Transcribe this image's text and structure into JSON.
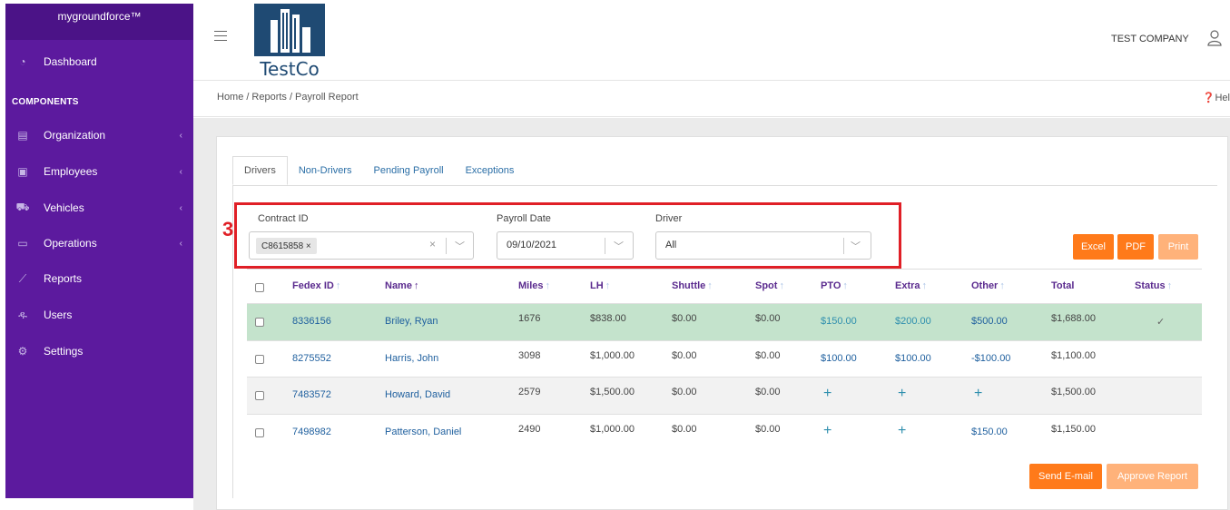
{
  "app": {
    "brand": "mygroundforce™",
    "logo_text": "TestCo",
    "company": "TEST COMPANY"
  },
  "sidebar": {
    "dashboard": "Dashboard",
    "section_title": "COMPONENTS",
    "items": [
      {
        "label": "Organization",
        "icon": "building-icon",
        "has_chevron": true
      },
      {
        "label": "Employees",
        "icon": "id-card-icon",
        "has_chevron": true
      },
      {
        "label": "Vehicles",
        "icon": "truck-icon",
        "has_chevron": true
      },
      {
        "label": "Operations",
        "icon": "calendar-icon",
        "has_chevron": true
      },
      {
        "label": "Reports",
        "icon": "chart-icon",
        "has_chevron": false
      },
      {
        "label": "Users",
        "icon": "users-icon",
        "has_chevron": false
      },
      {
        "label": "Settings",
        "icon": "gear-icon",
        "has_chevron": false
      }
    ]
  },
  "breadcrumb": {
    "home": "Home",
    "sep": "/",
    "reports": "Reports",
    "current": "Payroll Report",
    "help": "Hel"
  },
  "tabs": [
    "Drivers",
    "Non-Drivers",
    "Pending Payroll",
    "Exceptions"
  ],
  "filters": {
    "step_number": "3",
    "contract_label": "Contract ID",
    "contract_chip": "C8615858 ×",
    "date_label": "Payroll Date",
    "date_value": "09/10/2021",
    "driver_label": "Driver",
    "driver_value": "All"
  },
  "buttons": {
    "excel": "Excel",
    "pdf": "PDF",
    "print": "Print",
    "send_email": "Send E-mail",
    "approve": "Approve Report"
  },
  "table": {
    "headers": [
      "Fedex ID",
      "Name",
      "Miles",
      "LH",
      "Shuttle",
      "Spot",
      "PTO",
      "Extra",
      "Other",
      "Total",
      "Status"
    ],
    "rows": [
      {
        "id": "8336156",
        "name": "Briley, Ryan",
        "miles": "1676",
        "lh": "$838.00",
        "shuttle": "$0.00",
        "spot": "$0.00",
        "pto": "$150.00",
        "extra": "$200.00",
        "other": "$500.00",
        "total": "$1,688.00",
        "status": "✓"
      },
      {
        "id": "8275552",
        "name": "Harris, John",
        "miles": "3098",
        "lh": "$1,000.00",
        "shuttle": "$0.00",
        "spot": "$0.00",
        "pto": "$100.00",
        "extra": "$100.00",
        "other": "-$100.00",
        "total": "$1,100.00",
        "status": ""
      },
      {
        "id": "7483572",
        "name": "Howard, David",
        "miles": "2579",
        "lh": "$1,500.00",
        "shuttle": "$0.00",
        "spot": "$0.00",
        "pto": "+",
        "extra": "+",
        "other": "+",
        "total": "$1,500.00",
        "status": ""
      },
      {
        "id": "7498982",
        "name": "Patterson, Daniel",
        "miles": "2490",
        "lh": "$1,000.00",
        "shuttle": "$0.00",
        "spot": "$0.00",
        "pto": "+",
        "extra": "+",
        "other": "$150.00",
        "total": "$1,150.00",
        "status": ""
      }
    ]
  }
}
